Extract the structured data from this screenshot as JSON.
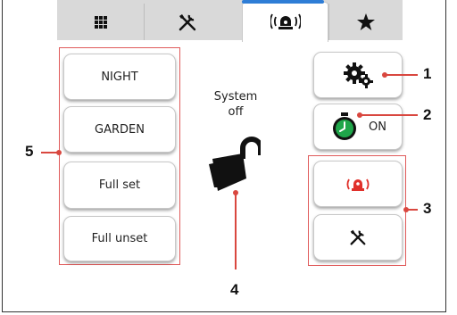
{
  "tabs": [
    {
      "icon": "grid-icon",
      "active": false
    },
    {
      "icon": "tools-icon",
      "active": false
    },
    {
      "icon": "alarm-beacon-icon",
      "active": true
    },
    {
      "icon": "star-icon",
      "active": false
    }
  ],
  "left_buttons": [
    "NIGHT",
    "GARDEN",
    "Full set",
    "Full unset"
  ],
  "status": {
    "line1": "System",
    "line2": "off",
    "icon": "padlock-open-icon"
  },
  "right_buttons": {
    "settings_icon": "gears-icon",
    "timer_icon": "timer-icon",
    "timer_label": "ON",
    "alarm_icon": "alarm-cycle-icon",
    "tools_icon": "tools-icon"
  },
  "callouts": {
    "c1": "1",
    "c2": "2",
    "c3": "3",
    "c4": "4",
    "c5": "5"
  },
  "colors": {
    "accent": "#2e7dd6",
    "callout": "#d9473f",
    "timer_green": "#1fa64a",
    "alarm_red": "#e0312b"
  }
}
